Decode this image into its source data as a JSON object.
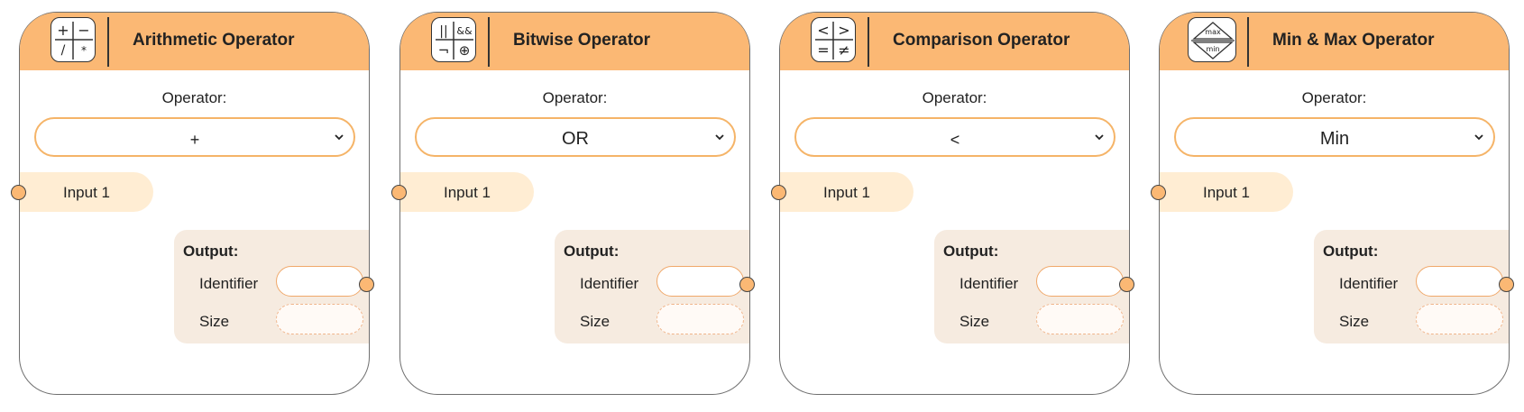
{
  "nodes": [
    {
      "title": "Arithmetic Operator",
      "icon": "arithmetic-icon",
      "icon_glyphs": [
        "+",
        "−",
        "/",
        "*"
      ],
      "operator_label": "Operator:",
      "operator_value": "+",
      "input_label": "Input 1",
      "output_title": "Output:",
      "identifier_label": "Identifier",
      "size_label": "Size",
      "identifier_value": "",
      "size_value": ""
    },
    {
      "title": "Bitwise Operator",
      "icon": "bitwise-icon",
      "icon_glyphs": [
        "||",
        "&&",
        "¬",
        "⊕"
      ],
      "operator_label": "Operator:",
      "operator_value": "OR",
      "input_label": "Input 1",
      "output_title": "Output:",
      "identifier_label": "Identifier",
      "size_label": "Size",
      "identifier_value": "",
      "size_value": ""
    },
    {
      "title": "Comparison Operator",
      "icon": "comparison-icon",
      "icon_glyphs": [
        "<",
        ">",
        "=",
        "≠"
      ],
      "operator_label": "Operator:",
      "operator_value": "<",
      "input_label": "Input 1",
      "output_title": "Output:",
      "identifier_label": "Identifier",
      "size_label": "Size",
      "identifier_value": "",
      "size_value": ""
    },
    {
      "title": "Min & Max Operator",
      "icon": "min-max-icon",
      "icon_glyphs": [
        "max",
        "min"
      ],
      "operator_label": "Operator:",
      "operator_value": "Min",
      "input_label": "Input 1",
      "output_title": "Output:",
      "identifier_label": "Identifier",
      "size_label": "Size",
      "identifier_value": "",
      "size_value": ""
    }
  ],
  "colors": {
    "header": "#fbb874",
    "input_pill": "#ffedd3",
    "output_panel": "#f6ebe0",
    "accent_border": "#f5b468"
  }
}
